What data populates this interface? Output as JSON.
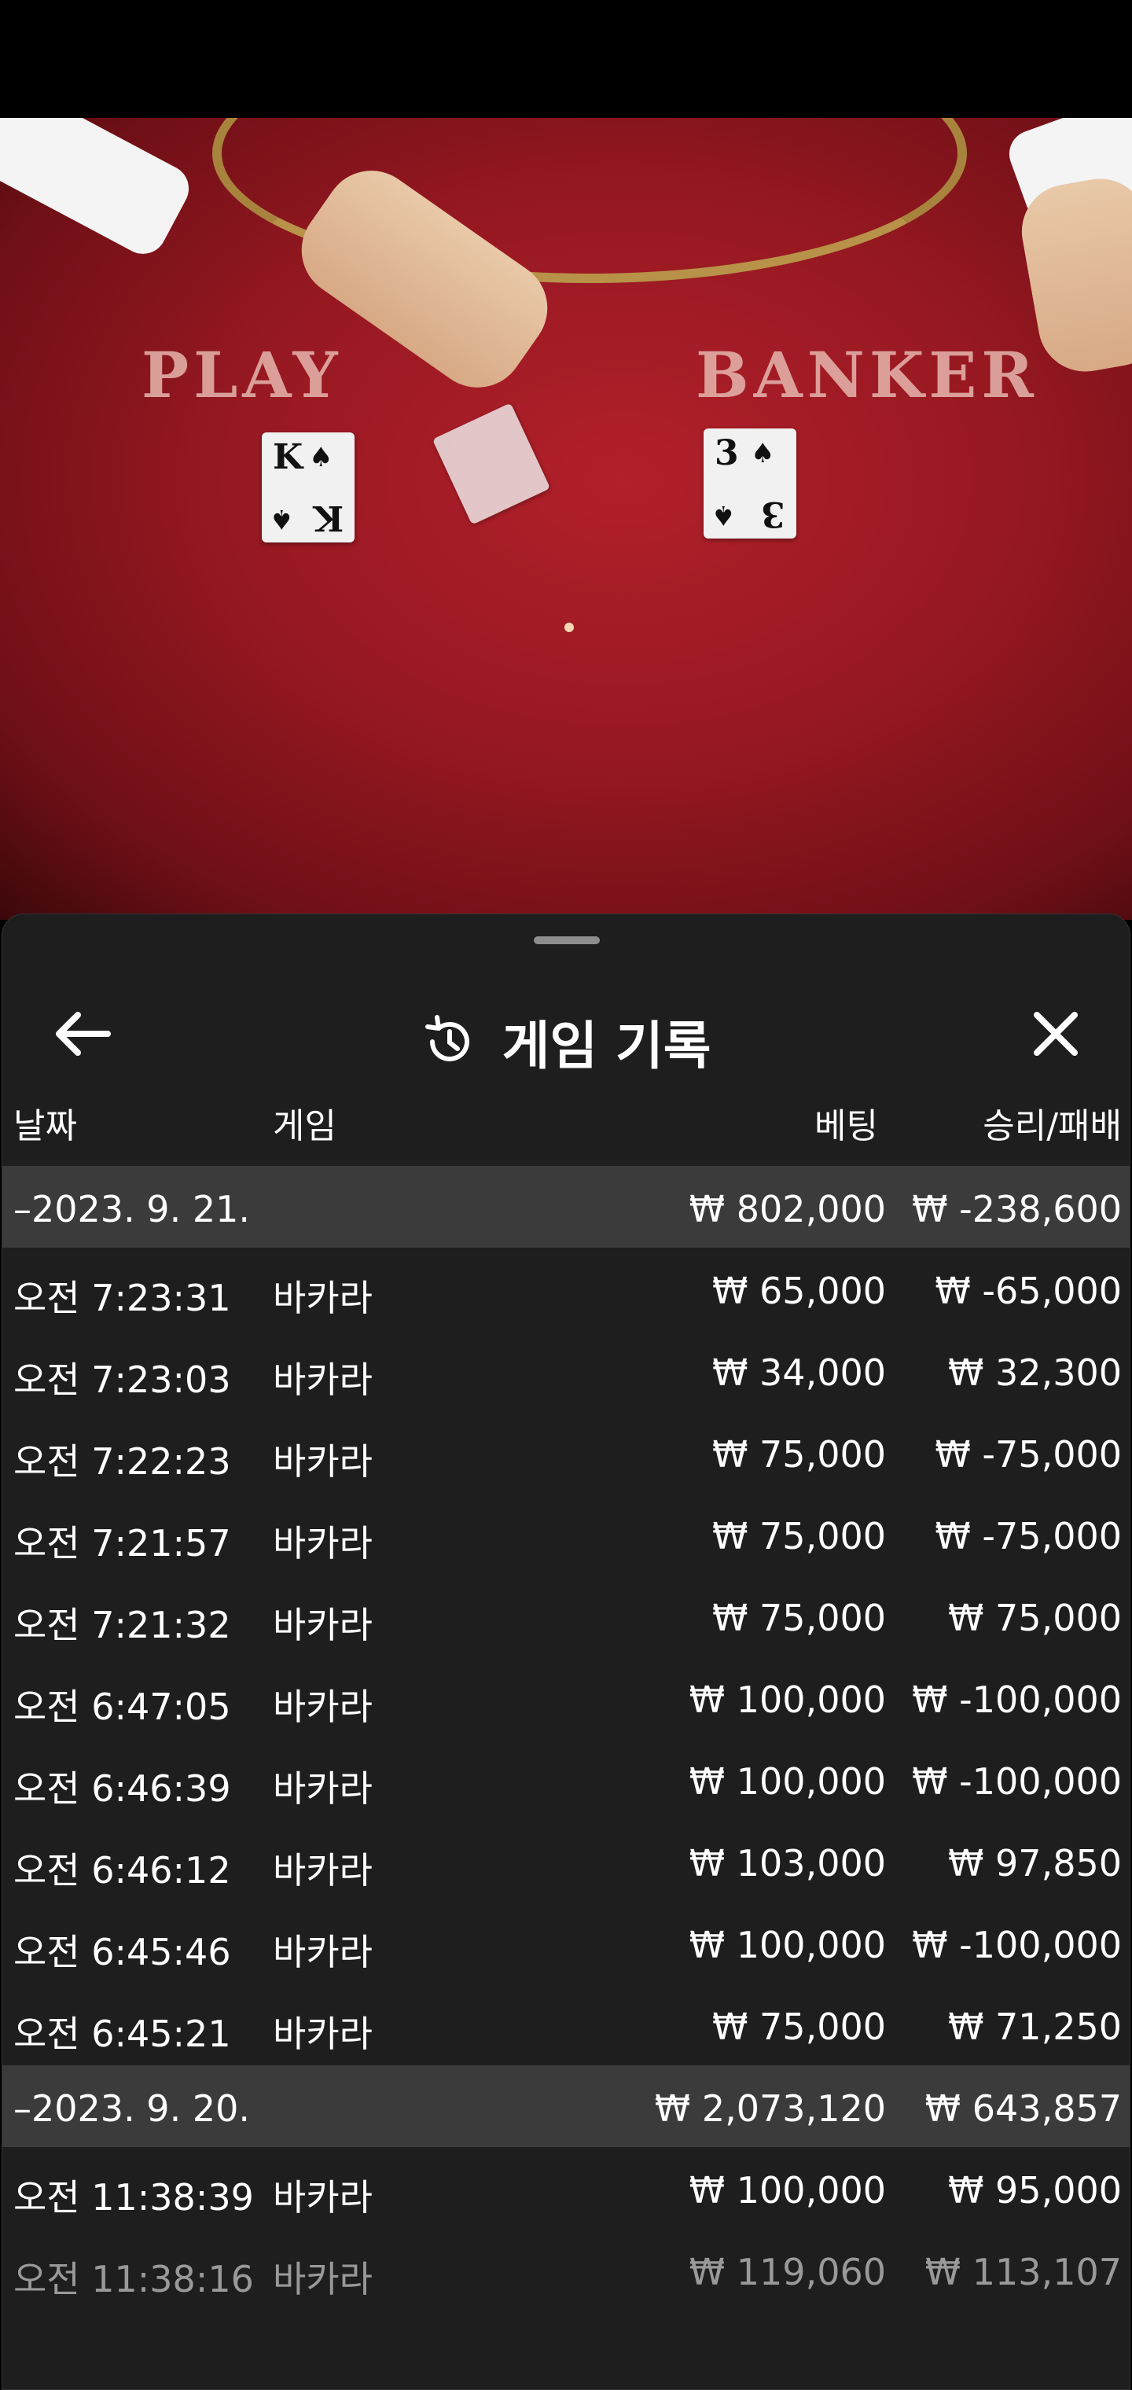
{
  "video": {
    "table_left_text": "PLAY",
    "table_right_text": "BANKER",
    "player_card": {
      "rank": "K",
      "suit": "♠"
    },
    "banker_card": {
      "rank": "3",
      "suit": "♠"
    }
  },
  "sheet": {
    "title": "게임 기록",
    "columns": {
      "date": "날짜",
      "game": "게임",
      "bet": "베팅",
      "win_loss": "승리/패배"
    },
    "rows": [
      {
        "type": "group",
        "time": "–2023. 9. 21.",
        "game": "",
        "bet": "₩ 802,000",
        "wl": "₩ -238,600"
      },
      {
        "type": "item",
        "time": "오전 7:23:31",
        "game": "바카라",
        "bet": "₩ 65,000",
        "wl": "₩ -65,000"
      },
      {
        "type": "item",
        "time": "오전 7:23:03",
        "game": "바카라",
        "bet": "₩ 34,000",
        "wl": "₩ 32,300"
      },
      {
        "type": "item",
        "time": "오전 7:22:23",
        "game": "바카라",
        "bet": "₩ 75,000",
        "wl": "₩ -75,000"
      },
      {
        "type": "item",
        "time": "오전 7:21:57",
        "game": "바카라",
        "bet": "₩ 75,000",
        "wl": "₩ -75,000"
      },
      {
        "type": "item",
        "time": "오전 7:21:32",
        "game": "바카라",
        "bet": "₩ 75,000",
        "wl": "₩ 75,000"
      },
      {
        "type": "item",
        "time": "오전 6:47:05",
        "game": "바카라",
        "bet": "₩ 100,000",
        "wl": "₩ -100,000"
      },
      {
        "type": "item",
        "time": "오전 6:46:39",
        "game": "바카라",
        "bet": "₩ 100,000",
        "wl": "₩ -100,000"
      },
      {
        "type": "item",
        "time": "오전 6:46:12",
        "game": "바카라",
        "bet": "₩ 103,000",
        "wl": "₩ 97,850"
      },
      {
        "type": "item",
        "time": "오전 6:45:46",
        "game": "바카라",
        "bet": "₩ 100,000",
        "wl": "₩ -100,000"
      },
      {
        "type": "item",
        "time": "오전 6:45:21",
        "game": "바카라",
        "bet": "₩ 75,000",
        "wl": "₩ 71,250"
      },
      {
        "type": "group",
        "time": "–2023. 9. 20.",
        "game": "",
        "bet": "₩ 2,073,120",
        "wl": "₩ 643,857"
      },
      {
        "type": "item",
        "time": "오전 11:38:39",
        "game": "바카라",
        "bet": "₩ 100,000",
        "wl": "₩ 95,000"
      },
      {
        "type": "item",
        "time": "오전 11:38:16",
        "game": "바카라",
        "bet": "₩ 119,060",
        "wl": "₩ 113,107",
        "faded": true
      }
    ]
  }
}
